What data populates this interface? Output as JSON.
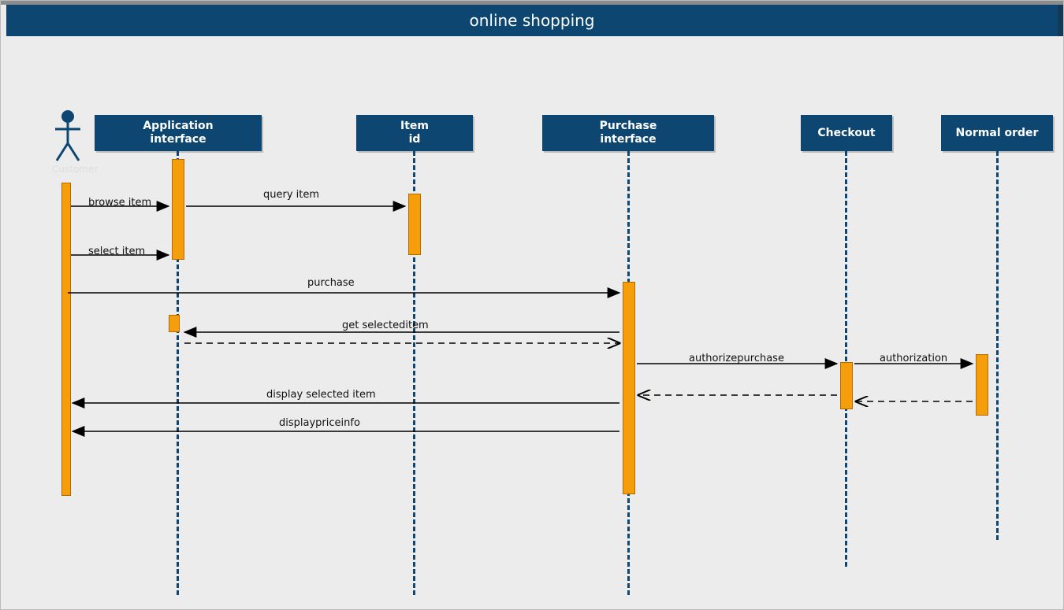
{
  "title": "online shopping",
  "actor": {
    "label": "Customer"
  },
  "lifelines": {
    "app": {
      "label": "Application\ninterface"
    },
    "item": {
      "label": "Item\nid"
    },
    "purchase": {
      "label": "Purchase\ninterface"
    },
    "checkout": {
      "label": "Checkout"
    },
    "normal": {
      "label": "Normal order"
    }
  },
  "messages": {
    "browse": "browse item",
    "query": "query item",
    "select": "select item",
    "purchase": "purchase",
    "getsel": "get selecteditem",
    "auth": "authorizepurchase",
    "authz": "authorization",
    "dispitem": "display selected item",
    "dispprice": "displaypriceinfo"
  },
  "chart_data": {
    "type": "sequence-diagram",
    "title": "online shopping",
    "actors": [
      "Customer"
    ],
    "lifelines": [
      "Application interface",
      "Item id",
      "Purchase interface",
      "Checkout",
      "Normal order"
    ],
    "interactions": [
      {
        "from": "Customer",
        "to": "Application interface",
        "label": "browse item",
        "kind": "sync"
      },
      {
        "from": "Application interface",
        "to": "Item id",
        "label": "query item",
        "kind": "sync"
      },
      {
        "from": "Customer",
        "to": "Application interface",
        "label": "select item",
        "kind": "sync"
      },
      {
        "from": "Customer",
        "to": "Purchase interface",
        "label": "purchase",
        "kind": "sync"
      },
      {
        "from": "Purchase interface",
        "to": "Application interface",
        "label": "get selecteditem",
        "kind": "sync"
      },
      {
        "from": "Application interface",
        "to": "Purchase interface",
        "label": "",
        "kind": "return"
      },
      {
        "from": "Purchase interface",
        "to": "Checkout",
        "label": "authorizepurchase",
        "kind": "sync"
      },
      {
        "from": "Checkout",
        "to": "Normal order",
        "label": "authorization",
        "kind": "sync"
      },
      {
        "from": "Normal order",
        "to": "Checkout",
        "label": "",
        "kind": "return"
      },
      {
        "from": "Checkout",
        "to": "Purchase interface",
        "label": "",
        "kind": "return"
      },
      {
        "from": "Purchase interface",
        "to": "Customer",
        "label": "display selected item",
        "kind": "sync"
      },
      {
        "from": "Purchase interface",
        "to": "Customer",
        "label": "displaypriceinfo",
        "kind": "sync"
      }
    ]
  }
}
